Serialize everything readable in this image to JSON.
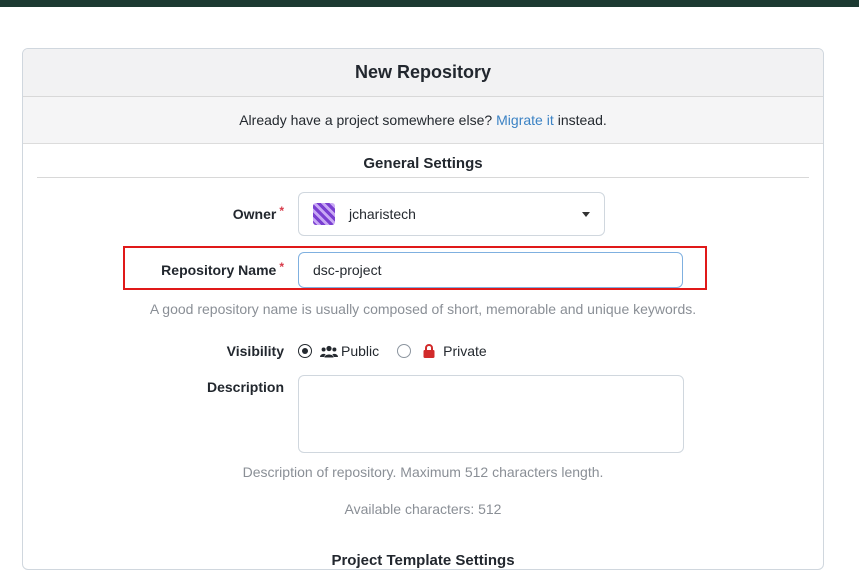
{
  "page": {
    "title": "New Repository",
    "migrate": {
      "prefix": "Already have a project somewhere else?",
      "link": "Migrate it",
      "suffix": "instead."
    },
    "section_title": "General Settings",
    "next_section_title": "Project Template Settings"
  },
  "form": {
    "owner": {
      "label": "Owner",
      "required_mark": "*",
      "value": "jcharistech"
    },
    "repo_name": {
      "label": "Repository Name",
      "required_mark": "*",
      "value": "dsc-project",
      "help": "A good repository name is usually composed of short, memorable and unique keywords."
    },
    "visibility": {
      "label": "Visibility",
      "public_label": "Public",
      "private_label": "Private",
      "selected": "Public"
    },
    "description": {
      "label": "Description",
      "value": "",
      "help": "Description of repository. Maximum 512 characters length.",
      "available": "Available characters: 512"
    }
  },
  "colors": {
    "accent_link": "#3b82c4",
    "highlight": "#e01919",
    "private_lock": "#d22b2b",
    "topbar": "#1c3a32"
  }
}
